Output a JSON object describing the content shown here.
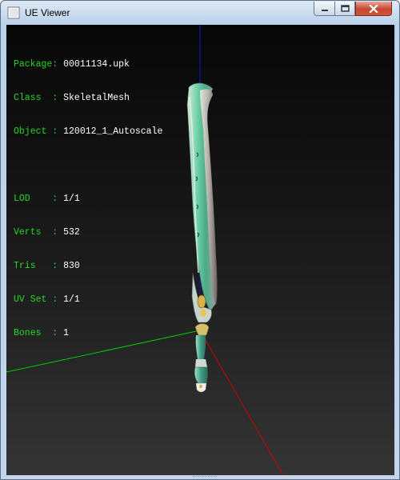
{
  "window": {
    "title": "UE Viewer"
  },
  "info": {
    "package": {
      "label": "Package:",
      "value": "00011134.upk"
    },
    "class": {
      "label": "Class  :",
      "value": "SkeletalMesh"
    },
    "object": {
      "label": "Object :",
      "value": "120012_1_Autoscale"
    },
    "lod": {
      "label": "LOD    :",
      "value": "1/1"
    },
    "verts": {
      "label": "Verts  :",
      "value": "532"
    },
    "tris": {
      "label": "Tris   :",
      "value": "830"
    },
    "uvset": {
      "label": "UV Set :",
      "value": "1/1"
    },
    "bones": {
      "label": "Bones  :",
      "value": "1"
    }
  },
  "colors": {
    "label_text": "#23d923",
    "value_text": "#ffffff",
    "axis_x": "#cc0000",
    "axis_y": "#00cc00",
    "axis_z": "#1010cc"
  }
}
